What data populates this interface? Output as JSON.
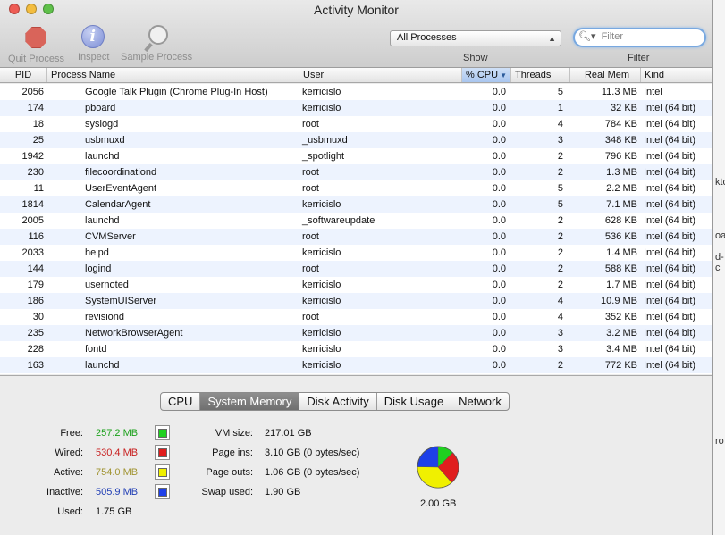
{
  "window": {
    "title": "Activity Monitor"
  },
  "toolbar": {
    "quit_label": "Quit Process",
    "inspect_label": "Inspect",
    "sample_label": "Sample Process",
    "show_label": "Show",
    "show_value": "All Processes",
    "filter_label": "Filter",
    "filter_placeholder": "Filter"
  },
  "table": {
    "headers": {
      "pid": "PID",
      "name": "Process Name",
      "user": "User",
      "cpu": "% CPU",
      "threads": "Threads",
      "mem": "Real Mem",
      "kind": "Kind"
    },
    "rows": [
      {
        "pid": "2056",
        "name": "Google Talk Plugin (Chrome Plug-In Host)",
        "user": "kerricislo",
        "cpu": "0.0",
        "threads": "5",
        "mem": "11.3 MB",
        "kind": "Intel"
      },
      {
        "pid": "174",
        "name": "pboard",
        "user": "kerricislo",
        "cpu": "0.0",
        "threads": "1",
        "mem": "32 KB",
        "kind": "Intel (64 bit)"
      },
      {
        "pid": "18",
        "name": "syslogd",
        "user": "root",
        "cpu": "0.0",
        "threads": "4",
        "mem": "784 KB",
        "kind": "Intel (64 bit)"
      },
      {
        "pid": "25",
        "name": "usbmuxd",
        "user": "_usbmuxd",
        "cpu": "0.0",
        "threads": "3",
        "mem": "348 KB",
        "kind": "Intel (64 bit)"
      },
      {
        "pid": "1942",
        "name": "launchd",
        "user": "_spotlight",
        "cpu": "0.0",
        "threads": "2",
        "mem": "796 KB",
        "kind": "Intel (64 bit)"
      },
      {
        "pid": "230",
        "name": "filecoordinationd",
        "user": "root",
        "cpu": "0.0",
        "threads": "2",
        "mem": "1.3 MB",
        "kind": "Intel (64 bit)"
      },
      {
        "pid": "11",
        "name": "UserEventAgent",
        "user": "root",
        "cpu": "0.0",
        "threads": "5",
        "mem": "2.2 MB",
        "kind": "Intel (64 bit)"
      },
      {
        "pid": "1814",
        "name": "CalendarAgent",
        "user": "kerricislo",
        "cpu": "0.0",
        "threads": "5",
        "mem": "7.1 MB",
        "kind": "Intel (64 bit)"
      },
      {
        "pid": "2005",
        "name": "launchd",
        "user": "_softwareupdate",
        "cpu": "0.0",
        "threads": "2",
        "mem": "628 KB",
        "kind": "Intel (64 bit)"
      },
      {
        "pid": "116",
        "name": "CVMServer",
        "user": "root",
        "cpu": "0.0",
        "threads": "2",
        "mem": "536 KB",
        "kind": "Intel (64 bit)"
      },
      {
        "pid": "2033",
        "name": "helpd",
        "user": "kerricislo",
        "cpu": "0.0",
        "threads": "2",
        "mem": "1.4 MB",
        "kind": "Intel (64 bit)"
      },
      {
        "pid": "144",
        "name": "logind",
        "user": "root",
        "cpu": "0.0",
        "threads": "2",
        "mem": "588 KB",
        "kind": "Intel (64 bit)"
      },
      {
        "pid": "179",
        "name": "usernoted",
        "user": "kerricislo",
        "cpu": "0.0",
        "threads": "2",
        "mem": "1.7 MB",
        "kind": "Intel (64 bit)"
      },
      {
        "pid": "186",
        "name": "SystemUIServer",
        "user": "kerricislo",
        "cpu": "0.0",
        "threads": "4",
        "mem": "10.9 MB",
        "kind": "Intel (64 bit)"
      },
      {
        "pid": "30",
        "name": "revisiond",
        "user": "root",
        "cpu": "0.0",
        "threads": "4",
        "mem": "352 KB",
        "kind": "Intel (64 bit)"
      },
      {
        "pid": "235",
        "name": "NetworkBrowserAgent",
        "user": "kerricislo",
        "cpu": "0.0",
        "threads": "3",
        "mem": "3.2 MB",
        "kind": "Intel (64 bit)"
      },
      {
        "pid": "228",
        "name": "fontd",
        "user": "kerricislo",
        "cpu": "0.0",
        "threads": "3",
        "mem": "3.4 MB",
        "kind": "Intel (64 bit)"
      },
      {
        "pid": "163",
        "name": "launchd",
        "user": "kerricislo",
        "cpu": "0.0",
        "threads": "2",
        "mem": "772 KB",
        "kind": "Intel (64 bit)"
      }
    ]
  },
  "tabs": [
    {
      "label": "CPU",
      "active": false
    },
    {
      "label": "System Memory",
      "active": true
    },
    {
      "label": "Disk Activity",
      "active": false
    },
    {
      "label": "Disk Usage",
      "active": false
    },
    {
      "label": "Network",
      "active": false
    }
  ],
  "memory": {
    "free_label": "Free:",
    "free_value": "257.2 MB",
    "free_color": "#19a019",
    "wired_label": "Wired:",
    "wired_value": "530.4 MB",
    "wired_color": "#c81e1e",
    "active_label": "Active:",
    "active_value": "754.0 MB",
    "active_color": "#a19432",
    "inactive_label": "Inactive:",
    "inactive_value": "505.9 MB",
    "inactive_color": "#1e3cb4",
    "used_label": "Used:",
    "used_value": "1.75 GB",
    "vm_label": "VM size:",
    "vm_value": "217.01 GB",
    "pageins_label": "Page ins:",
    "pageins_value": "3.10 GB (0 bytes/sec)",
    "pageouts_label": "Page outs:",
    "pageouts_value": "1.06 GB (0 bytes/sec)",
    "swap_label": "Swap used:",
    "swap_value": "1.90 GB",
    "total_value": "2.00 GB",
    "pie_colors": {
      "free": "#20d020",
      "wired": "#e01e1e",
      "active": "#f0f000",
      "inactive": "#1e40e8"
    }
  },
  "edge_fragments": [
    "kto",
    "oa",
    "d-c",
    "ro"
  ]
}
